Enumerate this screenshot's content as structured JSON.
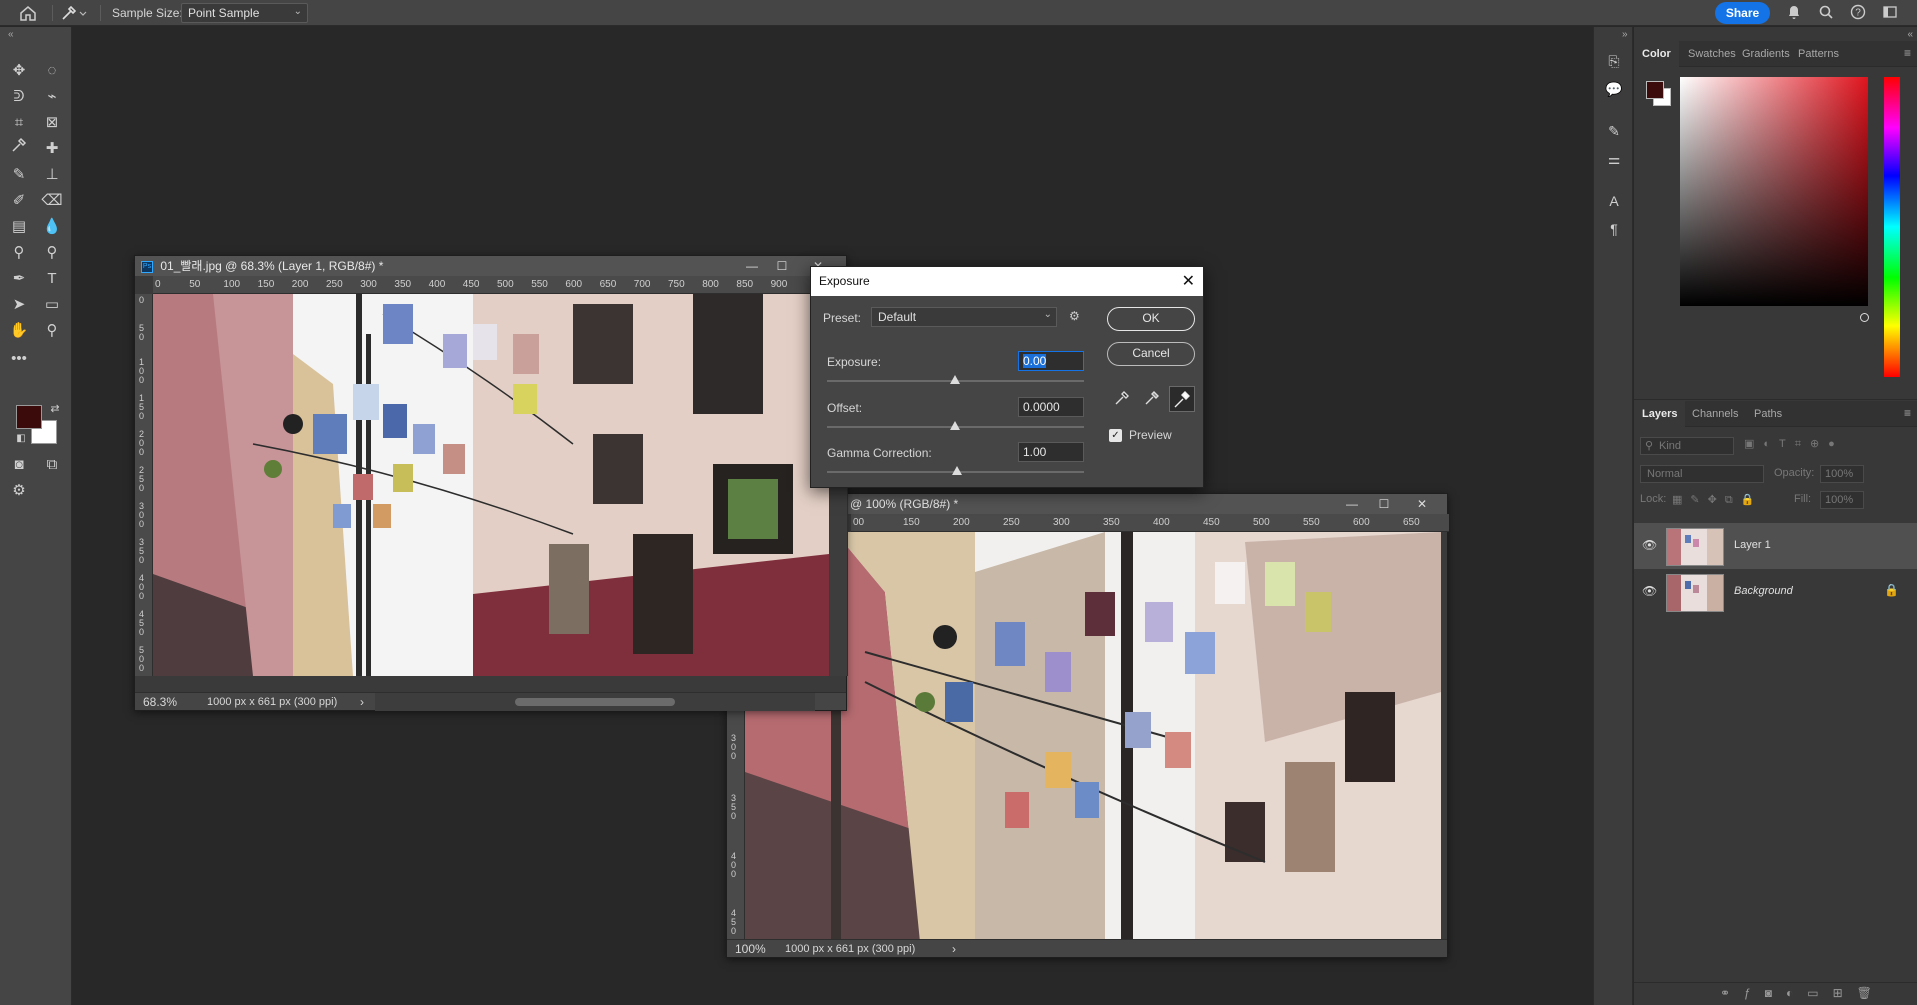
{
  "options_bar": {
    "sample_size_label": "Sample Size:",
    "sample_size_value": "Point Sample",
    "share_label": "Share"
  },
  "doc1": {
    "title": "01_빨래.jpg @ 68.3% (Layer 1, RGB/8#) *",
    "zoom": "68.3%",
    "info": "1000 px x 661 px (300 ppi)",
    "ruler_labels": [
      "0",
      "50",
      "100",
      "150",
      "200",
      "250",
      "300",
      "350",
      "400",
      "450",
      "500",
      "550",
      "600",
      "650",
      "700",
      "750",
      "800",
      "850",
      "900"
    ]
  },
  "doc2": {
    "title": "@ 100% (RGB/8#) *",
    "zoom": "100%",
    "info": "1000 px x 661 px (300 ppi)",
    "ruler_labels": [
      "00",
      "150",
      "200",
      "250",
      "300",
      "350",
      "400",
      "450",
      "500",
      "550",
      "600",
      "650"
    ]
  },
  "dialog": {
    "title": "Exposure",
    "preset_label": "Preset:",
    "preset_value": "Default",
    "exposure_label": "Exposure:",
    "exposure_value": "0.00",
    "offset_label": "Offset:",
    "offset_value": "0.0000",
    "gamma_label": "Gamma Correction:",
    "gamma_value": "1.00",
    "ok_label": "OK",
    "cancel_label": "Cancel",
    "preview_label": "Preview",
    "preview_checked": true
  },
  "color_panel": {
    "tabs": [
      "Color",
      "Swatches",
      "Gradients",
      "Patterns"
    ],
    "foreground": "#3b0a0a",
    "background": "#ffffff"
  },
  "layers_panel": {
    "tabs": [
      "Layers",
      "Channels",
      "Paths"
    ],
    "kind_label": "Kind",
    "blend_mode": "Normal",
    "opacity_label": "Opacity:",
    "opacity_value": "100%",
    "lock_label": "Lock:",
    "fill_label": "Fill:",
    "fill_value": "100%",
    "layers": [
      {
        "name": "Layer 1",
        "selected": true,
        "locked": false
      },
      {
        "name": "Background",
        "selected": false,
        "locked": true
      }
    ]
  },
  "colors": {
    "accent": "#1473e6",
    "app_bg": "#282828",
    "panel_bg": "#383838"
  }
}
